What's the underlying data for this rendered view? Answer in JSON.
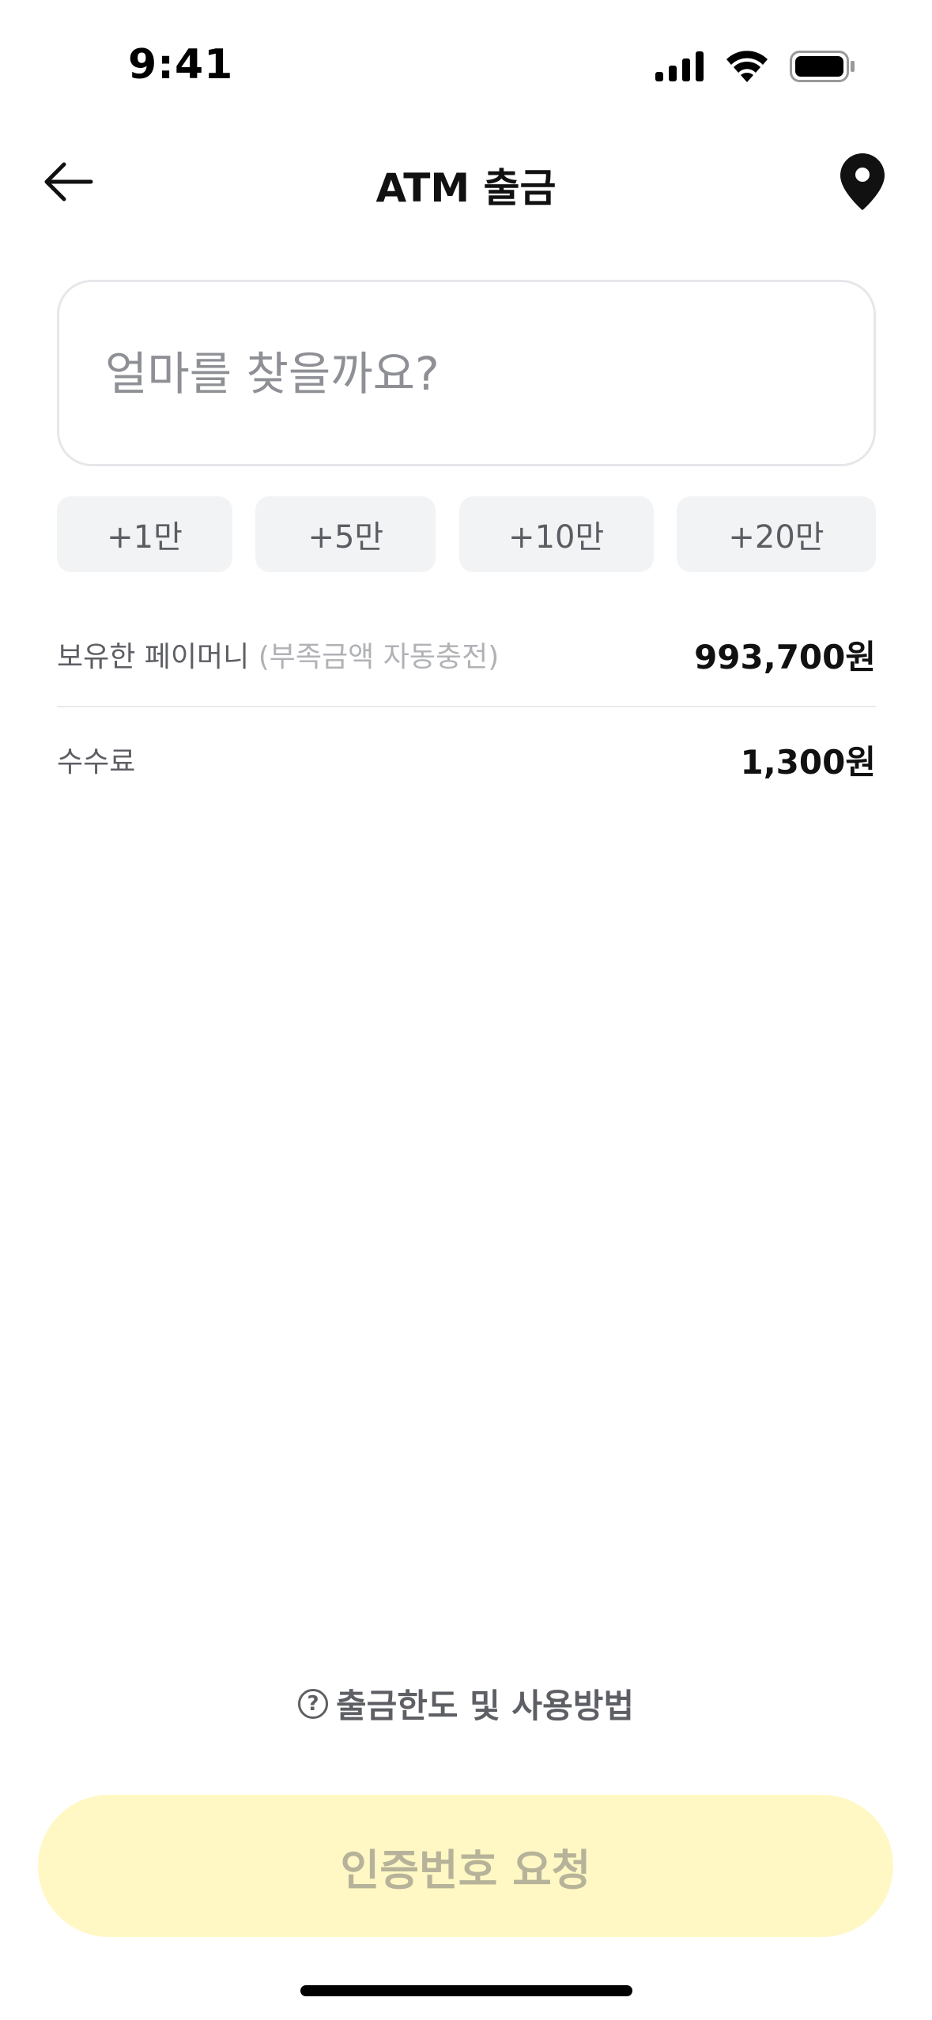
{
  "status_bar": {
    "time": "9:41"
  },
  "header": {
    "title": "ATM 출금"
  },
  "amount": {
    "placeholder": "얼마를 찾을까요?",
    "value": ""
  },
  "quick_add": [
    {
      "label": "+1만"
    },
    {
      "label": "+5만"
    },
    {
      "label": "+10만"
    },
    {
      "label": "+20만"
    }
  ],
  "balance": {
    "label": "보유한 페이머니",
    "sub_label": "(부족금액 자동충전)",
    "value": "993,700원"
  },
  "fee": {
    "label": "수수료",
    "value": "1,300원"
  },
  "help": {
    "icon_glyph": "?",
    "label": "출금한도 및 사용방법"
  },
  "primary_button": {
    "label": "인증번호 요청"
  },
  "icons": {
    "back": "arrow-left-icon",
    "location": "map-pin-icon",
    "help": "question-circle-icon"
  },
  "colors": {
    "primary_button_bg": "#fff8c4",
    "primary_button_text": "#b7b39a",
    "chip_bg": "#f2f3f5"
  }
}
